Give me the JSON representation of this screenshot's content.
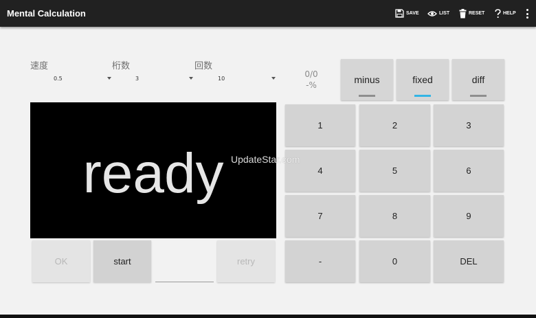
{
  "app": {
    "title": "Mental Calculation"
  },
  "actions": [
    {
      "id": "save",
      "label": "SAVE",
      "icon": "floppy-disk-icon"
    },
    {
      "id": "list",
      "label": "LIST",
      "icon": "eye-icon"
    },
    {
      "id": "reset",
      "label": "RESET",
      "icon": "trash-icon"
    },
    {
      "id": "help",
      "label": "HELP",
      "icon": "question-mark-icon"
    }
  ],
  "settings": {
    "speed": {
      "label": "速度",
      "value": "0.5"
    },
    "digits": {
      "label": "桁数",
      "value": "3"
    },
    "count": {
      "label": "回数",
      "value": "10"
    }
  },
  "score": {
    "ratio": "0/0",
    "percent": "-%"
  },
  "modes": [
    {
      "label": "minus",
      "active": false
    },
    {
      "label": "fixed",
      "active": true
    },
    {
      "label": "diff",
      "active": false
    }
  ],
  "display": {
    "text": "ready"
  },
  "controls": {
    "ok": "OK",
    "start": "start",
    "retry": "retry",
    "answer_value": ""
  },
  "keypad": {
    "k1": "1",
    "k2": "2",
    "k3": "3",
    "k4": "4",
    "k5": "5",
    "k6": "6",
    "k7": "7",
    "k8": "8",
    "k9": "9",
    "minus": "-",
    "k0": "0",
    "del": "DEL"
  },
  "watermark": "UpdateStar.com",
  "colors": {
    "actionbar": "#212121",
    "accent": "#33b5e5",
    "display_bg": "#000000"
  }
}
